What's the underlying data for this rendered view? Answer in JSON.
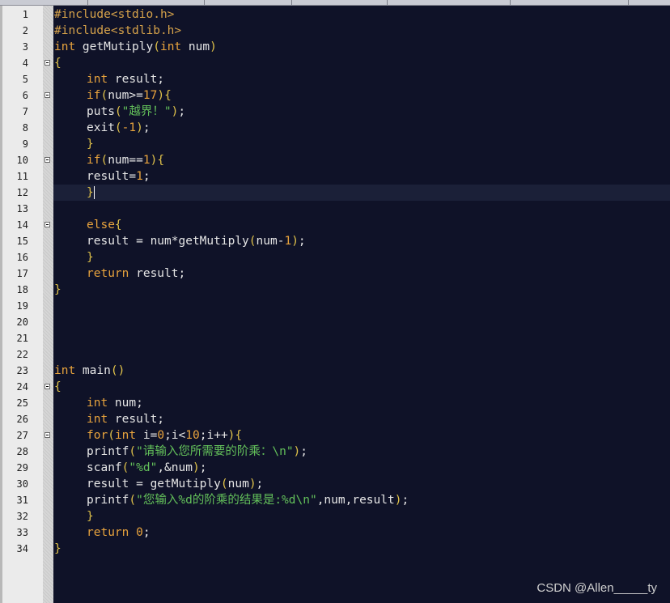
{
  "watermark": "CSDN @Allen_____ty",
  "code_lines": [
    {
      "n": "1",
      "fold": false,
      "indent": 0,
      "segs": [
        [
          "pp",
          "#include<stdio.h>"
        ]
      ]
    },
    {
      "n": "2",
      "fold": false,
      "indent": 0,
      "segs": [
        [
          "pp",
          "#include<stdlib.h>"
        ]
      ]
    },
    {
      "n": "3",
      "fold": false,
      "indent": 0,
      "segs": [
        [
          "kw",
          "int"
        ],
        [
          "op",
          " getMutiply"
        ],
        [
          "br",
          "("
        ],
        [
          "kw",
          "int"
        ],
        [
          "op",
          " num"
        ],
        [
          "br",
          ")"
        ]
      ]
    },
    {
      "n": "4",
      "fold": true,
      "indent": 0,
      "segs": [
        [
          "br",
          "{"
        ]
      ]
    },
    {
      "n": "5",
      "fold": false,
      "indent": 1,
      "segs": [
        [
          "kw",
          "int"
        ],
        [
          "op",
          " result;"
        ]
      ]
    },
    {
      "n": "6",
      "fold": true,
      "indent": 1,
      "segs": [
        [
          "kw",
          "if"
        ],
        [
          "br",
          "("
        ],
        [
          "op",
          "num>="
        ],
        [
          "num",
          "17"
        ],
        [
          "br",
          ")"
        ],
        [
          "br",
          "{"
        ]
      ]
    },
    {
      "n": "7",
      "fold": false,
      "indent": 1,
      "segs": [
        [
          "op",
          "puts"
        ],
        [
          "br",
          "("
        ],
        [
          "str",
          "\"越界！\""
        ],
        [
          "br",
          ")"
        ],
        [
          "op",
          ";"
        ]
      ]
    },
    {
      "n": "8",
      "fold": false,
      "indent": 1,
      "segs": [
        [
          "op",
          "exit"
        ],
        [
          "br",
          "("
        ],
        [
          "num",
          "-1"
        ],
        [
          "br",
          ")"
        ],
        [
          "op",
          ";"
        ]
      ]
    },
    {
      "n": "9",
      "fold": false,
      "indent": 1,
      "segs": [
        [
          "br",
          "}"
        ]
      ]
    },
    {
      "n": "10",
      "fold": true,
      "indent": 1,
      "segs": [
        [
          "kw",
          "if"
        ],
        [
          "br",
          "("
        ],
        [
          "op",
          "num=="
        ],
        [
          "num",
          "1"
        ],
        [
          "br",
          ")"
        ],
        [
          "br",
          "{"
        ]
      ]
    },
    {
      "n": "11",
      "fold": false,
      "indent": 1,
      "segs": [
        [
          "op",
          "result="
        ],
        [
          "num",
          "1"
        ],
        [
          "op",
          ";"
        ]
      ]
    },
    {
      "n": "12",
      "fold": false,
      "indent": 1,
      "segs": [
        [
          "br",
          "}"
        ]
      ],
      "current": true
    },
    {
      "n": "13",
      "fold": false,
      "indent": 0,
      "segs": []
    },
    {
      "n": "14",
      "fold": true,
      "indent": 1,
      "segs": [
        [
          "kw",
          "else"
        ],
        [
          "br",
          "{"
        ]
      ]
    },
    {
      "n": "15",
      "fold": false,
      "indent": 1,
      "segs": [
        [
          "op",
          "result = num*getMutiply"
        ],
        [
          "br",
          "("
        ],
        [
          "op",
          "num-"
        ],
        [
          "num",
          "1"
        ],
        [
          "br",
          ")"
        ],
        [
          "op",
          ";"
        ]
      ]
    },
    {
      "n": "16",
      "fold": false,
      "indent": 1,
      "segs": [
        [
          "br",
          "}"
        ]
      ]
    },
    {
      "n": "17",
      "fold": false,
      "indent": 1,
      "segs": [
        [
          "kw",
          "return"
        ],
        [
          "op",
          " result;"
        ]
      ]
    },
    {
      "n": "18",
      "fold": false,
      "indent": 0,
      "segs": [
        [
          "br",
          "}"
        ]
      ]
    },
    {
      "n": "19",
      "fold": false,
      "indent": 0,
      "segs": []
    },
    {
      "n": "20",
      "fold": false,
      "indent": 0,
      "segs": []
    },
    {
      "n": "21",
      "fold": false,
      "indent": 0,
      "segs": []
    },
    {
      "n": "22",
      "fold": false,
      "indent": 0,
      "segs": []
    },
    {
      "n": "23",
      "fold": false,
      "indent": 0,
      "segs": [
        [
          "kw",
          "int"
        ],
        [
          "op",
          " main"
        ],
        [
          "br",
          "()"
        ]
      ]
    },
    {
      "n": "24",
      "fold": true,
      "indent": 0,
      "segs": [
        [
          "br",
          "{"
        ]
      ]
    },
    {
      "n": "25",
      "fold": false,
      "indent": 1,
      "segs": [
        [
          "kw",
          "int"
        ],
        [
          "op",
          " num;"
        ]
      ]
    },
    {
      "n": "26",
      "fold": false,
      "indent": 1,
      "segs": [
        [
          "kw",
          "int"
        ],
        [
          "op",
          " result;"
        ]
      ]
    },
    {
      "n": "27",
      "fold": true,
      "indent": 1,
      "segs": [
        [
          "kw",
          "for"
        ],
        [
          "br",
          "("
        ],
        [
          "kw",
          "int"
        ],
        [
          "op",
          " i="
        ],
        [
          "num",
          "0"
        ],
        [
          "op",
          ";i<"
        ],
        [
          "num",
          "10"
        ],
        [
          "op",
          ";i++"
        ],
        [
          "br",
          ")"
        ],
        [
          "br",
          "{"
        ]
      ]
    },
    {
      "n": "28",
      "fold": false,
      "indent": 1,
      "segs": [
        [
          "op",
          "printf"
        ],
        [
          "br",
          "("
        ],
        [
          "str",
          "\"请输入您所需要的阶乘：\\n\""
        ],
        [
          "br",
          ")"
        ],
        [
          "op",
          ";"
        ]
      ]
    },
    {
      "n": "29",
      "fold": false,
      "indent": 1,
      "segs": [
        [
          "op",
          "scanf"
        ],
        [
          "br",
          "("
        ],
        [
          "str",
          "\"%d\""
        ],
        [
          "op",
          ",&num"
        ],
        [
          "br",
          ")"
        ],
        [
          "op",
          ";"
        ]
      ]
    },
    {
      "n": "30",
      "fold": false,
      "indent": 1,
      "segs": [
        [
          "op",
          "result = getMutiply"
        ],
        [
          "br",
          "("
        ],
        [
          "op",
          "num"
        ],
        [
          "br",
          ")"
        ],
        [
          "op",
          ";"
        ]
      ]
    },
    {
      "n": "31",
      "fold": false,
      "indent": 1,
      "segs": [
        [
          "op",
          "printf"
        ],
        [
          "br",
          "("
        ],
        [
          "str",
          "\"您输入%d的阶乘的结果是:%d\\n\""
        ],
        [
          "op",
          ",num,result"
        ],
        [
          "br",
          ")"
        ],
        [
          "op",
          ";"
        ]
      ]
    },
    {
      "n": "32",
      "fold": false,
      "indent": 1,
      "segs": [
        [
          "br",
          "}"
        ]
      ]
    },
    {
      "n": "33",
      "fold": false,
      "indent": 1,
      "segs": [
        [
          "kw",
          "return"
        ],
        [
          "op",
          " "
        ],
        [
          "num",
          "0"
        ],
        [
          "op",
          ";"
        ]
      ]
    },
    {
      "n": "34",
      "fold": false,
      "indent": 0,
      "segs": [
        [
          "br",
          "}"
        ]
      ]
    }
  ]
}
